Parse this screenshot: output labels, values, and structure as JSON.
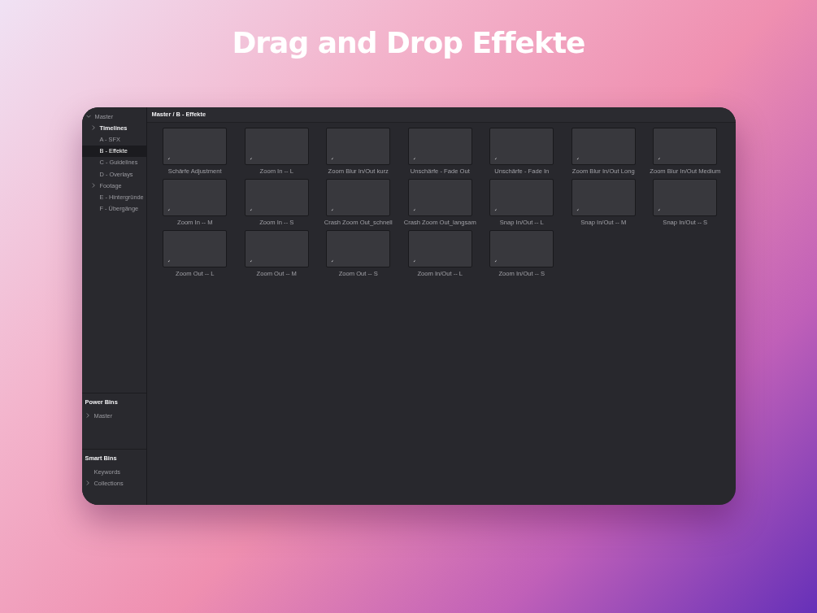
{
  "title": "Drag and Drop Effekte",
  "sidebar": {
    "tree": [
      {
        "label": "Master",
        "kind": "folder",
        "expanded": true,
        "selected": false,
        "children": [
          {
            "label": "Timelines",
            "kind": "folder",
            "expanded": false,
            "selected": false,
            "bold": true
          },
          {
            "label": "A - SFX",
            "kind": "bin",
            "selected": false
          },
          {
            "label": "B - Effekte",
            "kind": "bin",
            "selected": true
          },
          {
            "label": "C - Guidelines",
            "kind": "bin",
            "selected": false
          },
          {
            "label": "D - Overlays",
            "kind": "bin",
            "selected": false
          },
          {
            "label": "Footage",
            "kind": "folder",
            "expanded": false,
            "selected": false
          },
          {
            "label": "E - Hintergründe",
            "kind": "bin",
            "selected": false
          },
          {
            "label": "F - Übergänge",
            "kind": "bin",
            "selected": false
          }
        ]
      }
    ],
    "sections": [
      {
        "title": "Power Bins",
        "items": [
          {
            "label": "Master",
            "kind": "folder",
            "expanded": false
          }
        ]
      },
      {
        "title": "Smart Bins",
        "items": [
          {
            "label": "Keywords",
            "kind": "bin"
          },
          {
            "label": "Collections",
            "kind": "folder",
            "expanded": false
          }
        ]
      }
    ]
  },
  "breadcrumb": "Master / B - Effekte",
  "clips": [
    {
      "name": "Schärfe Adjustment"
    },
    {
      "name": "Zoom In -- L"
    },
    {
      "name": "Zoom Blur  In/Out kurz"
    },
    {
      "name": "Unschärfe - Fade Out"
    },
    {
      "name": "Unschärfe - Fade In"
    },
    {
      "name": "Zoom Blur  In/Out Long"
    },
    {
      "name": "Zoom Blur  In/Out Medium"
    },
    {
      "name": "Zoom In -- M"
    },
    {
      "name": "Zoom In -- S"
    },
    {
      "name": "Crash Zoom Out_schnell"
    },
    {
      "name": "Crash Zoom Out_langsam"
    },
    {
      "name": "Snap In/Out -- L"
    },
    {
      "name": "Snap In/Out -- M"
    },
    {
      "name": "Snap In/Out -- S"
    },
    {
      "name": "Zoom Out -- L"
    },
    {
      "name": "Zoom Out -- M"
    },
    {
      "name": "Zoom Out -- S"
    },
    {
      "name": "Zoom In/Out -- L"
    },
    {
      "name": "Zoom In/Out -- S"
    }
  ]
}
